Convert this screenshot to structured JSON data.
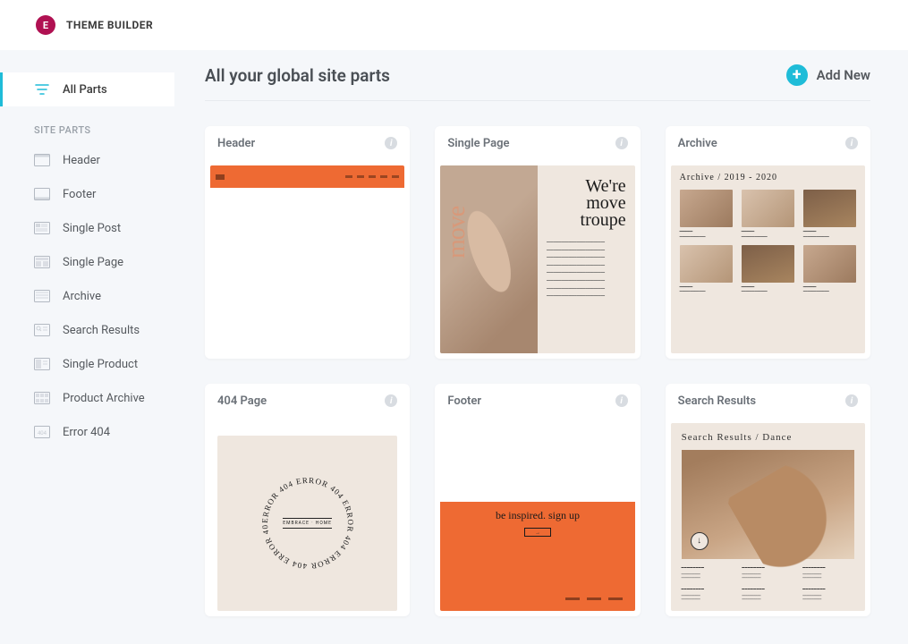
{
  "app": {
    "title": "THEME BUILDER",
    "logo_letter": "E"
  },
  "sidebar": {
    "all_parts": "All Parts",
    "heading": "SITE PARTS",
    "items": [
      {
        "label": "Header"
      },
      {
        "label": "Footer"
      },
      {
        "label": "Single Post"
      },
      {
        "label": "Single Page"
      },
      {
        "label": "Archive"
      },
      {
        "label": "Search Results"
      },
      {
        "label": "Single Product"
      },
      {
        "label": "Product Archive"
      },
      {
        "label": "Error 404"
      }
    ]
  },
  "main": {
    "title": "All your global site parts",
    "add_new": "Add New"
  },
  "cards": [
    {
      "title": "Header"
    },
    {
      "title": "Single Page"
    },
    {
      "title": "Archive"
    },
    {
      "title": "404 Page"
    },
    {
      "title": "Footer"
    },
    {
      "title": "Search Results"
    }
  ],
  "previews": {
    "single_page": {
      "side_text": "move",
      "headline_1": "We're",
      "headline_2": "move",
      "headline_3": "troupe"
    },
    "archive": {
      "title": "Archive  /  2019  -  2020"
    },
    "error404": {
      "circle_text": "ERROR 404 ERROR 404 ERROR 404 ERROR 404 ERROR 404 ERROR",
      "center": "EMBRACE · HOME"
    },
    "footer": {
      "headline": "be inspired. sign up",
      "arrow": "→"
    },
    "search": {
      "title": "Search Results  /  Dance",
      "arrow": "↓"
    }
  }
}
